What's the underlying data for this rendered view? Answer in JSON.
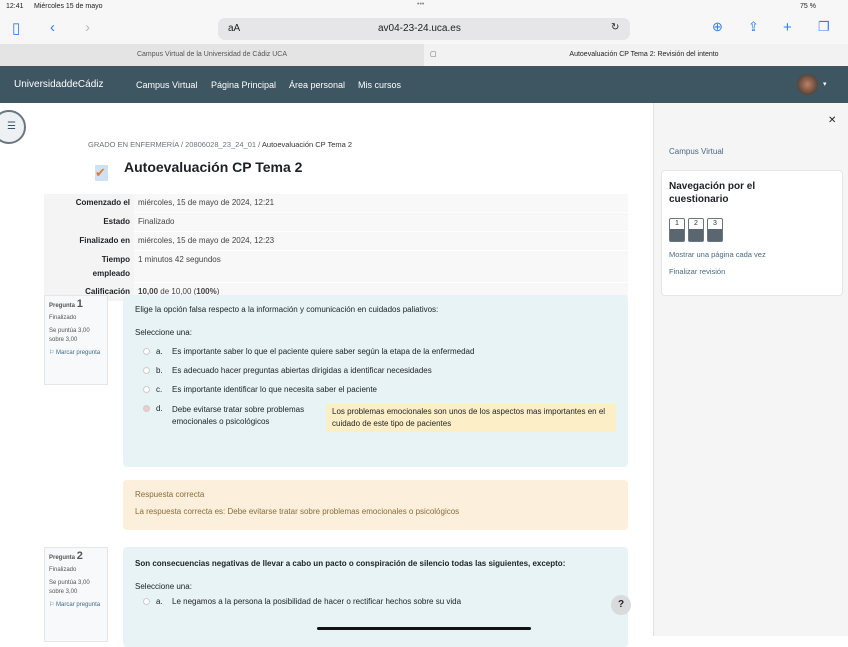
{
  "status": {
    "time": "12:41",
    "date": "Miércoles 15 de mayo",
    "battery": "75 %"
  },
  "browser": {
    "text_size": "aA",
    "url": "av04-23-24.uca.es",
    "tabs": [
      "Campus Virtual de la Universidad de Cádiz UCA",
      "Autoevaluación CP Tema 2: Revisión del intento"
    ]
  },
  "nav": {
    "logo": "UniversidaddeCádiz",
    "links": [
      "Campus Virtual",
      "Página Principal",
      "Área personal",
      "Mis cursos"
    ]
  },
  "breadcrumb": [
    "GRADO EN ENFERMERÍA",
    "20806028_23_24_01",
    "Autoevaluación CP Tema 2"
  ],
  "title": "Autoevaluación CP Tema 2",
  "summary": [
    {
      "label": "Comenzado el",
      "value": "miércoles, 15 de mayo de 2024, 12:21"
    },
    {
      "label": "Estado",
      "value": "Finalizado"
    },
    {
      "label": "Finalizado en",
      "value": "miércoles, 15 de mayo de 2024, 12:23"
    },
    {
      "label": "Tiempo empleado",
      "value": "1 minutos 42 segundos"
    },
    {
      "label": "Calificación",
      "value_bold": "10,00",
      "value_rest": " de 10,00 (",
      "percent": "100%",
      "close": ")"
    }
  ],
  "questions": [
    {
      "label": "Pregunta",
      "number": "1",
      "state": "Finalizado",
      "score": "Se puntúa 3,00 sobre 3,00",
      "flag": "Marcar pregunta",
      "text": "Elige la opción falsa respecto a la información y comunicación en cuidados paliativos:",
      "prompt": "Seleccione una:",
      "options": [
        {
          "letter": "a.",
          "text": "Es importante saber lo que el paciente quiere saber según la etapa de la enfermedad"
        },
        {
          "letter": "b.",
          "text": "Es adecuado hacer preguntas abiertas dirigidas a identificar necesidades"
        },
        {
          "letter": "c.",
          "text": "Es importante identificar lo que necesita saber el paciente"
        },
        {
          "letter": "d.",
          "text": "Debe evitarse tratar sobre problemas emocionales o psicológicos",
          "feedback": "Los problemas emocionales son unos de los aspectos mas importantes en el cuidado de este tipo de pacientes"
        }
      ],
      "result": "Respuesta correcta",
      "correct": "La respuesta correcta es: Debe evitarse tratar sobre problemas emocionales o psicológicos"
    },
    {
      "label": "Pregunta",
      "number": "2",
      "state": "Finalizado",
      "score": "Se puntúa 3,00 sobre 3,00",
      "flag": "Marcar pregunta",
      "text": "Son consecuencias negativas de llevar a cabo un pacto o conspiración de silencio todas las siguientes, excepto:",
      "prompt": "Seleccione una:",
      "options": [
        {
          "letter": "a.",
          "text": "Le negamos a la persona la posibilidad de hacer o rectificar hechos sobre su vida"
        }
      ]
    }
  ],
  "drawer": {
    "campus": "Campus Virtual",
    "heading": "Navegación por el cuestionario",
    "pages": [
      "1",
      "2",
      "3"
    ],
    "show_one": "Mostrar una página cada vez",
    "finish": "Finalizar revisión"
  },
  "help": "?"
}
